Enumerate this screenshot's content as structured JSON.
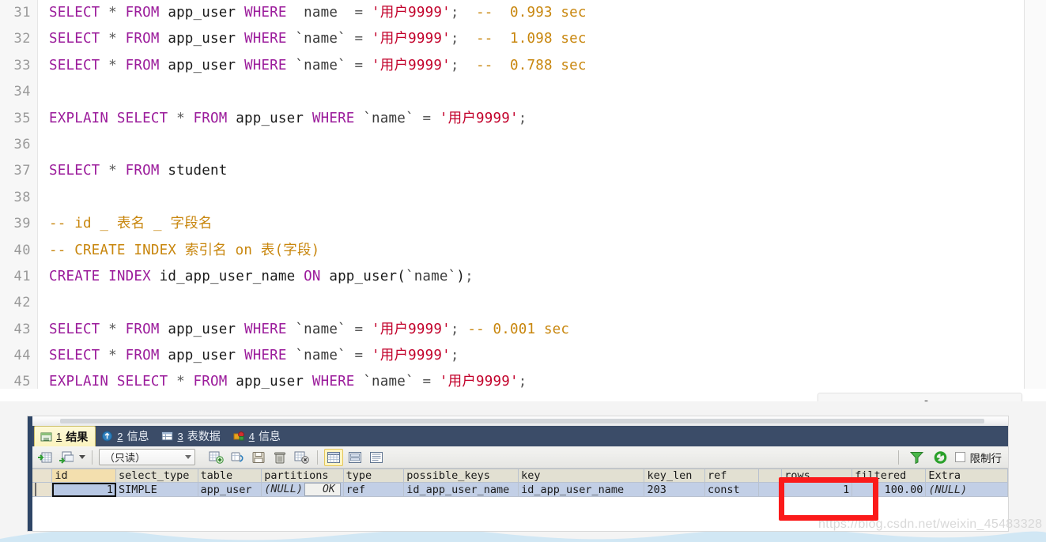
{
  "editor": {
    "lines": [
      {
        "num": "31",
        "tokens": [
          {
            "t": "kw",
            "v": "SELECT"
          },
          {
            "t": "op",
            "v": " * "
          },
          {
            "t": "kw",
            "v": "FROM"
          },
          {
            "t": "ident",
            "v": " app_user "
          },
          {
            "t": "kw",
            "v": "WHERE"
          },
          {
            "t": "bq",
            "v": "  name  "
          },
          {
            "t": "op",
            "v": "= "
          },
          {
            "t": "str",
            "v": "'用户9999'"
          },
          {
            "t": "op",
            "v": ";  "
          },
          {
            "t": "cmt",
            "v": "--  0.993 sec"
          }
        ]
      },
      {
        "num": "32",
        "tokens": [
          {
            "t": "kw",
            "v": "SELECT"
          },
          {
            "t": "op",
            "v": " * "
          },
          {
            "t": "kw",
            "v": "FROM"
          },
          {
            "t": "ident",
            "v": " app_user "
          },
          {
            "t": "kw",
            "v": "WHERE"
          },
          {
            "t": "bq",
            "v": " `name` "
          },
          {
            "t": "op",
            "v": "= "
          },
          {
            "t": "str",
            "v": "'用户9999'"
          },
          {
            "t": "op",
            "v": ";  "
          },
          {
            "t": "cmt",
            "v": "--  1.098 sec"
          }
        ]
      },
      {
        "num": "33",
        "tokens": [
          {
            "t": "kw",
            "v": "SELECT"
          },
          {
            "t": "op",
            "v": " * "
          },
          {
            "t": "kw",
            "v": "FROM"
          },
          {
            "t": "ident",
            "v": " app_user "
          },
          {
            "t": "kw",
            "v": "WHERE"
          },
          {
            "t": "bq",
            "v": " `name` "
          },
          {
            "t": "op",
            "v": "= "
          },
          {
            "t": "str",
            "v": "'用户9999'"
          },
          {
            "t": "op",
            "v": ";  "
          },
          {
            "t": "cmt",
            "v": "--  0.788 sec"
          }
        ]
      },
      {
        "num": "34",
        "tokens": []
      },
      {
        "num": "35",
        "tokens": [
          {
            "t": "kw",
            "v": "EXPLAIN"
          },
          {
            "t": "op",
            "v": " "
          },
          {
            "t": "kw",
            "v": "SELECT"
          },
          {
            "t": "op",
            "v": " * "
          },
          {
            "t": "kw",
            "v": "FROM"
          },
          {
            "t": "ident",
            "v": " app_user "
          },
          {
            "t": "kw",
            "v": "WHERE"
          },
          {
            "t": "bq",
            "v": " `name` "
          },
          {
            "t": "op",
            "v": "= "
          },
          {
            "t": "str",
            "v": "'用户9999'"
          },
          {
            "t": "op",
            "v": ";"
          }
        ]
      },
      {
        "num": "36",
        "tokens": []
      },
      {
        "num": "37",
        "tokens": [
          {
            "t": "kw",
            "v": "SELECT"
          },
          {
            "t": "op",
            "v": " * "
          },
          {
            "t": "kw",
            "v": "FROM"
          },
          {
            "t": "ident",
            "v": " student"
          }
        ]
      },
      {
        "num": "38",
        "tokens": []
      },
      {
        "num": "39",
        "tokens": [
          {
            "t": "cmt",
            "v": "-- id _ 表名 _ 字段名"
          }
        ]
      },
      {
        "num": "40",
        "tokens": [
          {
            "t": "cmt",
            "v": "-- CREATE INDEX 索引名 on 表(字段)"
          }
        ]
      },
      {
        "num": "41",
        "tokens": [
          {
            "t": "kw",
            "v": "CREATE"
          },
          {
            "t": "op",
            "v": " "
          },
          {
            "t": "kw",
            "v": "INDEX"
          },
          {
            "t": "ident",
            "v": " id_app_user_name "
          },
          {
            "t": "kw",
            "v": "ON"
          },
          {
            "t": "ident",
            "v": " app_user("
          },
          {
            "t": "bq",
            "v": "`name`"
          },
          {
            "t": "ident",
            "v": ")"
          },
          {
            "t": "op",
            "v": ";"
          }
        ]
      },
      {
        "num": "42",
        "tokens": []
      },
      {
        "num": "43",
        "tokens": [
          {
            "t": "kw",
            "v": "SELECT"
          },
          {
            "t": "op",
            "v": " * "
          },
          {
            "t": "kw",
            "v": "FROM"
          },
          {
            "t": "ident",
            "v": " app_user "
          },
          {
            "t": "kw",
            "v": "WHERE"
          },
          {
            "t": "bq",
            "v": " `name` "
          },
          {
            "t": "op",
            "v": "= "
          },
          {
            "t": "str",
            "v": "'用户9999'"
          },
          {
            "t": "op",
            "v": "; "
          },
          {
            "t": "cmt",
            "v": "-- 0.001 sec"
          }
        ]
      },
      {
        "num": "44",
        "tokens": [
          {
            "t": "kw",
            "v": "SELECT"
          },
          {
            "t": "op",
            "v": " * "
          },
          {
            "t": "kw",
            "v": "FROM"
          },
          {
            "t": "ident",
            "v": " app_user "
          },
          {
            "t": "kw",
            "v": "WHERE"
          },
          {
            "t": "bq",
            "v": " `name` "
          },
          {
            "t": "op",
            "v": "= "
          },
          {
            "t": "str",
            "v": "'用户9999'"
          },
          {
            "t": "op",
            "v": ";"
          }
        ]
      },
      {
        "num": "45",
        "tokens": [
          {
            "t": "kw",
            "v": "EXPLAIN"
          },
          {
            "t": "op",
            "v": " "
          },
          {
            "t": "kw",
            "v": "SELECT"
          },
          {
            "t": "op",
            "v": " * "
          },
          {
            "t": "kw",
            "v": "FROM"
          },
          {
            "t": "ident",
            "v": " app_user "
          },
          {
            "t": "kw",
            "v": "WHERE"
          },
          {
            "t": "bq",
            "v": " `name` "
          },
          {
            "t": "op",
            "v": "= "
          },
          {
            "t": "str",
            "v": "'用户9999'"
          },
          {
            "t": "op",
            "v": ";"
          }
        ]
      }
    ]
  },
  "sql_chip": {
    "label": "sql"
  },
  "result_panel": {
    "tabs": [
      {
        "num": "1",
        "label": "结果",
        "icon": "result-grid-icon",
        "active": true
      },
      {
        "num": "2",
        "label": "信息",
        "icon": "info-blue-icon",
        "active": false
      },
      {
        "num": "3",
        "label": "表数据",
        "icon": "table-data-icon",
        "active": false
      },
      {
        "num": "4",
        "label": "信息",
        "icon": "info-color-icon",
        "active": false
      }
    ],
    "toolbar": {
      "mode_select_value": "（只读）",
      "buttons": [
        {
          "name": "import-grid-button"
        },
        {
          "name": "export-grid-button"
        },
        {
          "name": "add-record-button"
        },
        {
          "name": "duplicate-record-button"
        },
        {
          "name": "save-record-button"
        },
        {
          "name": "delete-record-button"
        },
        {
          "name": "cancel-record-button"
        },
        {
          "name": "view-grid-button"
        },
        {
          "name": "view-form-button"
        },
        {
          "name": "view-text-button"
        }
      ],
      "filter_icon": "filter-funnel-icon",
      "refresh_icon": "refresh-icon",
      "limit_rows_label": "限制行",
      "limit_rows_checked": false
    },
    "grid": {
      "columns": [
        "id",
        "select_type",
        "table",
        "partitions",
        "type",
        "possible_keys",
        "key",
        "key_len",
        "ref",
        "",
        "rows",
        "filtered",
        "Extra"
      ],
      "rows": [
        {
          "id": "1",
          "select_type": "SIMPLE",
          "table": "app_user",
          "partitions": "(NULL)",
          "partitions_badge": "OK",
          "type": "ref",
          "possible_keys": "id_app_user_name",
          "key": "id_app_user_name",
          "key_len": "203",
          "ref": "const",
          "spacer": "",
          "rows": "1",
          "filtered": "100.00",
          "extra": "(NULL)"
        }
      ]
    },
    "annotation": {
      "name": "rows-highlight-rect",
      "color": "#fb1a1a"
    }
  },
  "watermark": {
    "text": "https://blog.csdn.net/weixin_45483328"
  }
}
